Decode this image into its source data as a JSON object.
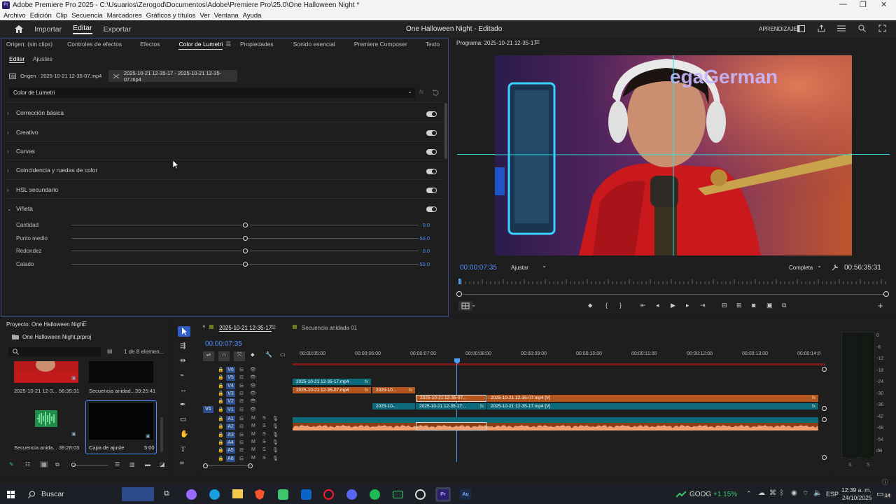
{
  "window": {
    "title": "Adobe Premiere Pro 2025 - C:\\Usuarios\\Zerogod\\Documentos\\Adobe\\Premiere Pro\\25.0\\One Halloween Night *",
    "controls": [
      "—",
      "❐",
      "✕"
    ]
  },
  "menu": [
    "Archivo",
    "Edición",
    "Clip",
    "Secuencia",
    "Marcadores",
    "Gráficos y títulos",
    "Ver",
    "Ventana",
    "Ayuda"
  ],
  "topbar": {
    "nav": [
      "Importar",
      "Editar",
      "Exportar"
    ],
    "active": "Editar",
    "project_title": "One Halloween Night - Editado",
    "learning": "APRENDIZAJE"
  },
  "lumetri": {
    "tabs": [
      "Origen: (sin clips)",
      "Controles de efectos",
      "Efectos",
      "Color de Lumetri",
      "Propiedades",
      "Sonido esencial",
      "Premiere Composer",
      "Texto"
    ],
    "active_tab": "Color de Lumetri",
    "subtabs": [
      "Editar",
      "Ajustes"
    ],
    "source_clip": "Origen - 2025-10-21 12-35-07.mp4",
    "seq_clip": "2025-10-21 12-35-17 - 2025-10-21 12-35-07.mp4",
    "effect_select": "Color de Lumetri",
    "sections": [
      "Corrección básica",
      "Creativo",
      "Curvas",
      "Coincidencia y ruedas de color",
      "HSL secundario",
      "Viñeta"
    ],
    "vignette": [
      {
        "label": "Cantidad",
        "value": "0.0"
      },
      {
        "label": "Punto medio",
        "value": "50.0"
      },
      {
        "label": "Redondez",
        "value": "0.0"
      },
      {
        "label": "Calado",
        "value": "50.0"
      }
    ]
  },
  "program": {
    "title": "Programa: 2025-10-21 12-35-17",
    "timecode": "00:00:07:35",
    "fit": "Ajustar",
    "quality": "Completa",
    "duration": "00:56:35:31",
    "video_text": "egaGerman"
  },
  "project": {
    "title": "Proyecto: One Halloween Night",
    "file": "One Halloween Night.prproj",
    "count": "1 de 8 elemen...",
    "items": [
      {
        "name": "2025-10-21 12-3...",
        "duration": "56:35:31"
      },
      {
        "name": "Secuencia anidad...",
        "duration": "39:25:41"
      },
      {
        "name": "Secuencia anida...",
        "duration": "39:28:03"
      },
      {
        "name": "Capa de ajuste",
        "duration": "5:00"
      }
    ]
  },
  "timeline": {
    "tabs": [
      "2025-10-21 12-35-17",
      "Secuencia anidada 01"
    ],
    "timecode": "00:00:07:35",
    "ruler": [
      "00:00:05:00",
      "00:00:06:00",
      "00:00:07:00",
      "00:00:08:00",
      "00:00:09:00",
      "00:00:10:00",
      "00:00:11:00",
      "00:00:12:00",
      "00:00:13:00",
      "00:00:14:0"
    ],
    "video_tracks": [
      "V6",
      "V5",
      "V4",
      "V3",
      "V2",
      "V1"
    ],
    "audio_tracks": [
      "A1",
      "A2",
      "A3",
      "A4",
      "A5",
      "A6"
    ],
    "source_patch": "V1",
    "clips": {
      "v4": "2025-10-21 12-35-17.mp4",
      "v3a": "2025-10-21 12-35-07.mp4",
      "v3b": "2025-10...",
      "v2a": "2025-10-21 12-35-07...",
      "v2b": "2025-10-21 12-35-07.mp4 [V]",
      "v1a": "2025-10-...",
      "v1b": "2025-10-21 12-35-17...",
      "v1c": "2025-10-21 12-35-17.mp4 [V]"
    },
    "fx": "fx"
  },
  "meters": {
    "scale": [
      "0",
      "-6",
      "-12",
      "-18",
      "-24",
      "-30",
      "-36",
      "-42",
      "-48",
      "-54",
      "dB"
    ],
    "solo": [
      "S",
      "S"
    ]
  },
  "taskbar": {
    "search": "Buscar",
    "stock": "GOOG",
    "change": "+1.15%",
    "lang": "ESP",
    "time": "12:39 a. m.",
    "date": "24/10/2025",
    "notifications": "14"
  },
  "colors": {
    "accent": "#4f8fff",
    "clip_teal": "#0d6a7a",
    "clip_orange": "#b4551d",
    "playhead": "#4a9fff",
    "stock_up": "#3ec46d"
  }
}
